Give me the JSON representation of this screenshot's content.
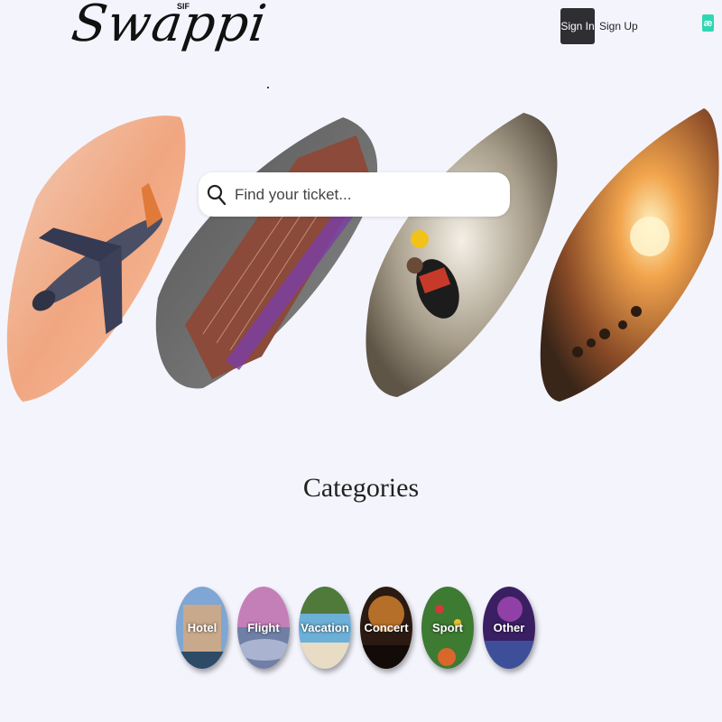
{
  "header": {
    "logo_text": "Swappi",
    "logo_sup": "SIF",
    "sign_in_label": "Sign In",
    "sign_up_label": "Sign Up",
    "lang_badge": "æ"
  },
  "search": {
    "placeholder": "Find your ticket..."
  },
  "categories": {
    "title": "Categories",
    "items": [
      {
        "label": "Hotel"
      },
      {
        "label": "Flight"
      },
      {
        "label": "Vacation"
      },
      {
        "label": "Concert"
      },
      {
        "label": "Sport"
      },
      {
        "label": "Other"
      }
    ]
  },
  "colors": {
    "background": "#f4f4fd",
    "sign_in_bg": "#2e2e33",
    "lang_badge_bg": "#2fd7b3"
  }
}
